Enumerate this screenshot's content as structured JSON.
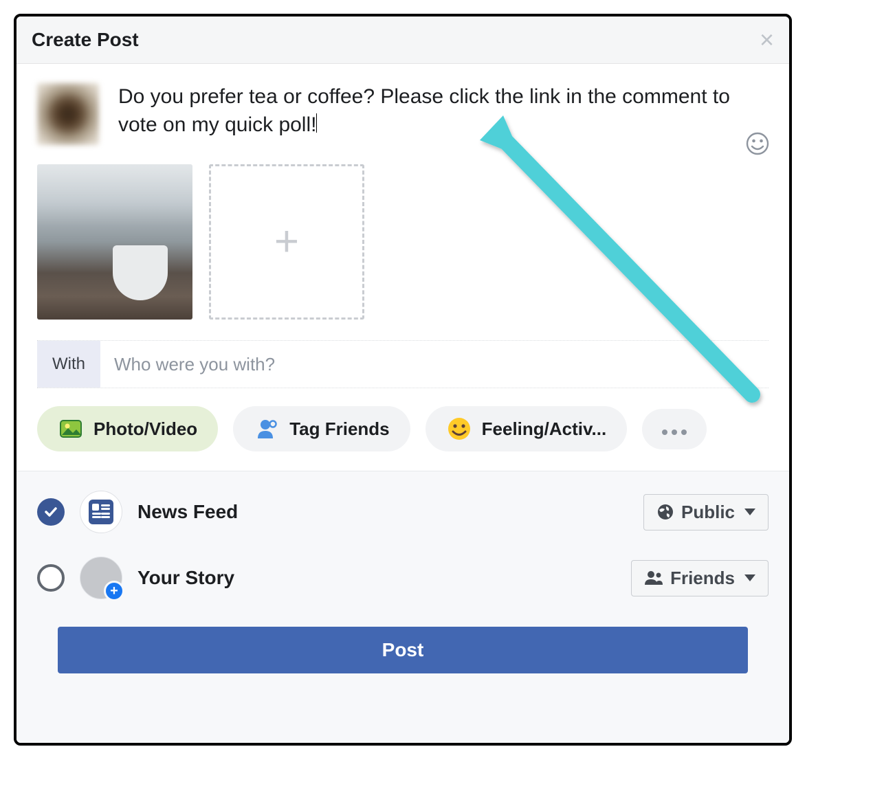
{
  "header": {
    "title": "Create Post"
  },
  "compose": {
    "text": "Do you prefer tea or coffee? Please click the link in the comment to vote on my quick poll!"
  },
  "with": {
    "label": "With",
    "placeholder": "Who were you with?"
  },
  "chips": {
    "photo": "Photo/Video",
    "tag": "Tag Friends",
    "feeling": "Feeling/Activ..."
  },
  "destinations": {
    "feed": {
      "label": "News Feed",
      "audience": "Public"
    },
    "story": {
      "label": "Your Story",
      "audience": "Friends"
    }
  },
  "submit": {
    "label": "Post"
  }
}
